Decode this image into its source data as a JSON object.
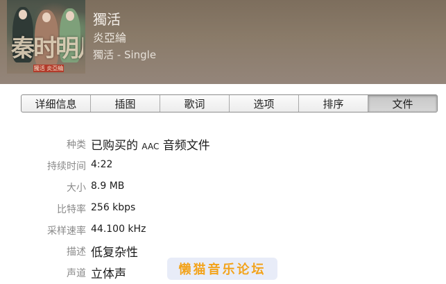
{
  "header": {
    "title": "獨活",
    "artist": "炎亞綸",
    "album": "獨活 - Single",
    "cover_logo_text": "秦时明月",
    "cover_stamp_text": "獨活 炎亞綸"
  },
  "tabs": [
    {
      "label": "详细信息",
      "active": false
    },
    {
      "label": "插图",
      "active": false
    },
    {
      "label": "歌词",
      "active": false
    },
    {
      "label": "选项",
      "active": false
    },
    {
      "label": "排序",
      "active": false
    },
    {
      "label": "文件",
      "active": true
    }
  ],
  "file_info": {
    "kind_label": "种类",
    "kind_value_pre": "已购买的",
    "kind_value_aac": "AAC",
    "kind_value_post": "音频文件",
    "duration_label": "持续时间",
    "duration_value": "4:22",
    "size_label": "大小",
    "size_value": "8.9 MB",
    "bitrate_label": "比特率",
    "bitrate_value": "256 kbps",
    "samplerate_label": "采样速率",
    "samplerate_value": "44.100 kHz",
    "description_label": "描述",
    "description_value": "低复杂性",
    "channels_label": "声道",
    "channels_value": "立体声"
  },
  "watermark": "懒猫音乐论坛",
  "colors": {
    "header_bg": "#8a7b69",
    "label_gray": "#8a8a8a",
    "watermark_orange": "#f3a31b",
    "active_tab": "#cfcfcf"
  }
}
